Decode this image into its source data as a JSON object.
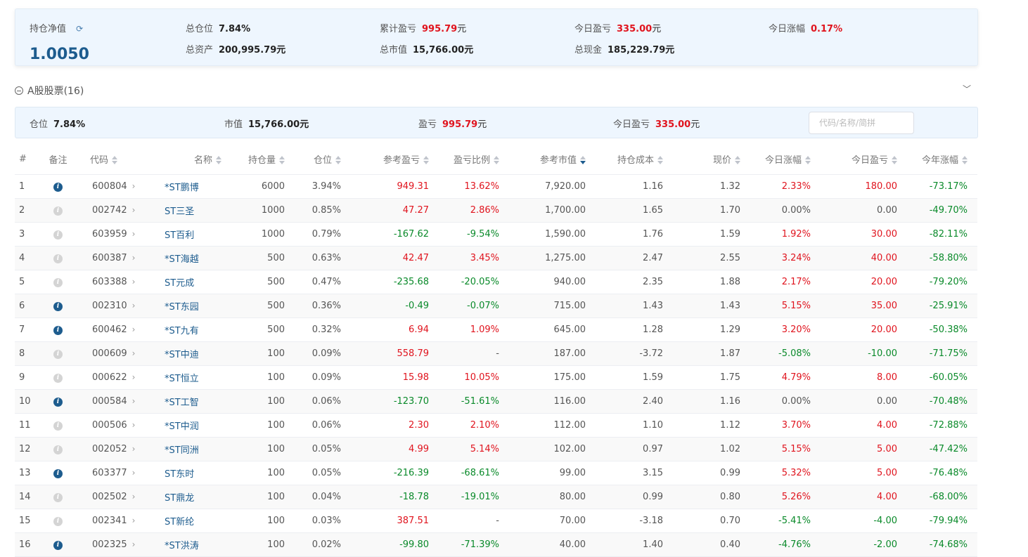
{
  "summary": {
    "nav_label": "持仓净值",
    "nav_value": "1.0050",
    "position_label": "总仓位",
    "position_value": "7.84%",
    "assets_label": "总资产",
    "assets_value": "200,995.79元",
    "cum_pl_label": "累计盈亏",
    "cum_pl_value": "995.79",
    "cum_pl_unit": "元",
    "market_value_label": "总市值",
    "market_value_value": "15,766.00元",
    "today_pl_label": "今日盈亏",
    "today_pl_value": "335.00",
    "today_pl_unit": "元",
    "cash_label": "总现金",
    "cash_value": "185,229.79元",
    "today_change_label": "今日涨幅",
    "today_change_value": "0.17%"
  },
  "section": {
    "title": "A股股票(16)",
    "position_label": "仓位",
    "position_value": "7.84%",
    "market_value_label": "市值",
    "market_value_value": "15,766.00元",
    "pl_label": "盈亏",
    "pl_value": "995.79",
    "pl_unit": "元",
    "today_pl_label": "今日盈亏",
    "today_pl_value": "335.00",
    "today_pl_unit": "元",
    "search_placeholder": "代码/名称/简拼"
  },
  "colors": {
    "up": "#e0141e",
    "down": "#0a8a2a",
    "accent": "#1d5c8e"
  },
  "table": {
    "headers": [
      "#",
      "备注",
      "代码",
      "名称",
      "持仓量",
      "仓位",
      "参考盈亏",
      "盈亏比例",
      "参考市值",
      "持仓成本",
      "现价",
      "今日涨幅",
      "今日盈亏",
      "今年涨幅"
    ],
    "sorted_column": "参考市值",
    "rows": [
      {
        "idx": "1",
        "note": true,
        "code": "600804",
        "name": "*ST鹏博",
        "qty": "6000",
        "pos": "3.94%",
        "pl": "949.31",
        "pl_pct": "13.62%",
        "mv": "7,920.00",
        "cost": "1.16",
        "price": "1.32",
        "chg": "2.33%",
        "today_pl": "180.00",
        "ytd": "-73.17%"
      },
      {
        "idx": "2",
        "note": false,
        "code": "002742",
        "name": "ST三圣",
        "qty": "1000",
        "pos": "0.85%",
        "pl": "47.27",
        "pl_pct": "2.86%",
        "mv": "1,700.00",
        "cost": "1.65",
        "price": "1.70",
        "chg": "0.00%",
        "today_pl": "0.00",
        "ytd": "-49.70%"
      },
      {
        "idx": "3",
        "note": false,
        "code": "603959",
        "name": "ST百利",
        "qty": "1000",
        "pos": "0.79%",
        "pl": "-167.62",
        "pl_pct": "-9.54%",
        "mv": "1,590.00",
        "cost": "1.76",
        "price": "1.59",
        "chg": "1.92%",
        "today_pl": "30.00",
        "ytd": "-82.11%"
      },
      {
        "idx": "4",
        "note": false,
        "code": "600387",
        "name": "*ST海越",
        "qty": "500",
        "pos": "0.63%",
        "pl": "42.47",
        "pl_pct": "3.45%",
        "mv": "1,275.00",
        "cost": "2.47",
        "price": "2.55",
        "chg": "3.24%",
        "today_pl": "40.00",
        "ytd": "-58.80%"
      },
      {
        "idx": "5",
        "note": false,
        "code": "603388",
        "name": "ST元成",
        "qty": "500",
        "pos": "0.47%",
        "pl": "-235.68",
        "pl_pct": "-20.05%",
        "mv": "940.00",
        "cost": "2.35",
        "price": "1.88",
        "chg": "2.17%",
        "today_pl": "20.00",
        "ytd": "-79.20%"
      },
      {
        "idx": "6",
        "note": true,
        "code": "002310",
        "name": "*ST东园",
        "qty": "500",
        "pos": "0.36%",
        "pl": "-0.49",
        "pl_pct": "-0.07%",
        "mv": "715.00",
        "cost": "1.43",
        "price": "1.43",
        "chg": "5.15%",
        "today_pl": "35.00",
        "ytd": "-25.91%"
      },
      {
        "idx": "7",
        "note": true,
        "code": "600462",
        "name": "*ST九有",
        "qty": "500",
        "pos": "0.32%",
        "pl": "6.94",
        "pl_pct": "1.09%",
        "mv": "645.00",
        "cost": "1.28",
        "price": "1.29",
        "chg": "3.20%",
        "today_pl": "20.00",
        "ytd": "-50.38%"
      },
      {
        "idx": "8",
        "note": false,
        "code": "000609",
        "name": "*ST中迪",
        "qty": "100",
        "pos": "0.09%",
        "pl": "558.79",
        "pl_pct": "-",
        "mv": "187.00",
        "cost": "-3.72",
        "price": "1.87",
        "chg": "-5.08%",
        "today_pl": "-10.00",
        "ytd": "-71.75%"
      },
      {
        "idx": "9",
        "note": false,
        "code": "000622",
        "name": "*ST恒立",
        "qty": "100",
        "pos": "0.09%",
        "pl": "15.98",
        "pl_pct": "10.05%",
        "mv": "175.00",
        "cost": "1.59",
        "price": "1.75",
        "chg": "4.79%",
        "today_pl": "8.00",
        "ytd": "-60.05%"
      },
      {
        "idx": "10",
        "note": true,
        "code": "000584",
        "name": "*ST工智",
        "qty": "100",
        "pos": "0.06%",
        "pl": "-123.70",
        "pl_pct": "-51.61%",
        "mv": "116.00",
        "cost": "2.40",
        "price": "1.16",
        "chg": "0.00%",
        "today_pl": "0.00",
        "ytd": "-70.48%"
      },
      {
        "idx": "11",
        "note": false,
        "code": "000506",
        "name": "*ST中润",
        "qty": "100",
        "pos": "0.06%",
        "pl": "2.30",
        "pl_pct": "2.10%",
        "mv": "112.00",
        "cost": "1.10",
        "price": "1.12",
        "chg": "3.70%",
        "today_pl": "4.00",
        "ytd": "-72.88%"
      },
      {
        "idx": "12",
        "note": false,
        "code": "002052",
        "name": "*ST同洲",
        "qty": "100",
        "pos": "0.05%",
        "pl": "4.99",
        "pl_pct": "5.14%",
        "mv": "102.00",
        "cost": "0.97",
        "price": "1.02",
        "chg": "5.15%",
        "today_pl": "5.00",
        "ytd": "-47.42%"
      },
      {
        "idx": "13",
        "note": true,
        "code": "603377",
        "name": "ST东时",
        "qty": "100",
        "pos": "0.05%",
        "pl": "-216.39",
        "pl_pct": "-68.61%",
        "mv": "99.00",
        "cost": "3.15",
        "price": "0.99",
        "chg": "5.32%",
        "today_pl": "5.00",
        "ytd": "-76.48%"
      },
      {
        "idx": "14",
        "note": false,
        "code": "002502",
        "name": "ST鼎龙",
        "qty": "100",
        "pos": "0.04%",
        "pl": "-18.78",
        "pl_pct": "-19.01%",
        "mv": "80.00",
        "cost": "0.99",
        "price": "0.80",
        "chg": "5.26%",
        "today_pl": "4.00",
        "ytd": "-68.00%"
      },
      {
        "idx": "15",
        "note": false,
        "code": "002341",
        "name": "ST新纶",
        "qty": "100",
        "pos": "0.03%",
        "pl": "387.51",
        "pl_pct": "-",
        "mv": "70.00",
        "cost": "-3.18",
        "price": "0.70",
        "chg": "-5.41%",
        "today_pl": "-4.00",
        "ytd": "-79.94%"
      },
      {
        "idx": "16",
        "note": true,
        "code": "002325",
        "name": "*ST洪涛",
        "qty": "100",
        "pos": "0.02%",
        "pl": "-99.80",
        "pl_pct": "-71.39%",
        "mv": "40.00",
        "cost": "1.40",
        "price": "0.40",
        "chg": "-4.76%",
        "today_pl": "-2.00",
        "ytd": "-74.68%"
      }
    ]
  }
}
